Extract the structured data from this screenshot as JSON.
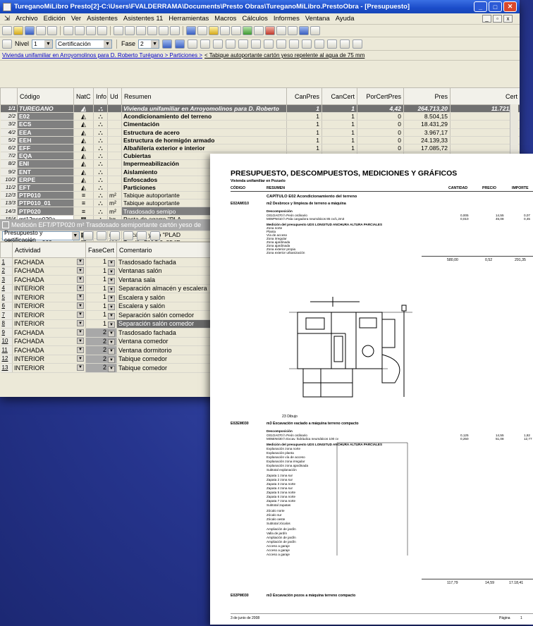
{
  "window": {
    "title": "TureganoMiLibro Presto[2]-C:\\Users\\FVALDERRAMA\\Documents\\Presto Obras\\TureganoMiLibro.PrestoObra - [Presupuesto]"
  },
  "menu": [
    "Archivo",
    "Edición",
    "Ver",
    "Asistentes",
    "Asistentes 11",
    "Herramientas",
    "Macros",
    "Cálculos",
    "Informes",
    "Ventana",
    "Ayuda"
  ],
  "filter": {
    "nivel_label": "Nivel",
    "nivel_value": "1",
    "certificacion_value": "Certificación",
    "fase_label": "Fase",
    "fase_value": "2"
  },
  "breadcrumb": {
    "path": "Vivienda unifamiliar en Arroyomolinos para D. Roberto Turégano > Particiones >",
    "current": "< Tabique autoportante cartón yeso repelente al agua de 75 mm"
  },
  "budget_grid": {
    "columns": [
      "Código",
      "NatC",
      "Info",
      "Ud",
      "Resumen",
      "CanPres",
      "CanCert",
      "PorCertPres",
      "Pres",
      "Cert"
    ],
    "rows": [
      {
        "n": "1/1",
        "code": "TUREGANO",
        "ud": "",
        "res": "Vivienda unifamiliar en Arroyomolinos para D. Roberto",
        "cp": "1",
        "cc": "1",
        "pcp": "4,42",
        "pres": "264.713,20",
        "cert": "11.721,68",
        "kind": "top"
      },
      {
        "n": "2/2",
        "code": "E02",
        "ud": "",
        "res": "Acondicionamiento del terreno",
        "cp": "1",
        "cc": "1",
        "pcp": "0",
        "pres": "8.504,15",
        "cert": "",
        "kind": "bold"
      },
      {
        "n": "3/2",
        "code": "ECS",
        "ud": "",
        "res": "Cimentación",
        "cp": "1",
        "cc": "1",
        "pcp": "0",
        "pres": "18.431,29",
        "cert": "",
        "kind": "bold"
      },
      {
        "n": "4/2",
        "code": "EEA",
        "ud": "",
        "res": "Estructura de acero",
        "cp": "1",
        "cc": "1",
        "pcp": "0",
        "pres": "3.967,17",
        "cert": "",
        "kind": "bold"
      },
      {
        "n": "5/2",
        "code": "EEH",
        "ud": "",
        "res": "Estructura de hormigón armado",
        "cp": "1",
        "cc": "1",
        "pcp": "0",
        "pres": "24.139,33",
        "cert": "",
        "kind": "bold"
      },
      {
        "n": "6/2",
        "code": "EFF",
        "ud": "",
        "res": "Albañilería exterior e interior",
        "cp": "1",
        "cc": "1",
        "pcp": "0",
        "pres": "17.085,72",
        "cert": "",
        "kind": "bold"
      },
      {
        "n": "7/2",
        "code": "EQA",
        "ud": "",
        "res": "Cubiertas",
        "cp": "1",
        "cc": "1",
        "pcp": "0",
        "pres": "5.861,87",
        "cert": "",
        "kind": "bold"
      },
      {
        "n": "8/2",
        "code": "ENI",
        "ud": "",
        "res": "Impermeabilización",
        "cp": "1",
        "cc": "1",
        "pcp": "0",
        "pres": "8.483,53",
        "cert": "",
        "kind": "bold"
      },
      {
        "n": "9/2",
        "code": "ENT",
        "ud": "",
        "res": "Aislamiento",
        "cp": "1",
        "cc": "1",
        "pcp": "0",
        "pres": "4.577,57",
        "cert": "",
        "kind": "bold"
      },
      {
        "n": "10/2",
        "code": "ERPE",
        "ud": "",
        "res": "Enfoscados",
        "cp": "",
        "cc": "",
        "pcp": "",
        "pres": "",
        "cert": "",
        "kind": "bold"
      },
      {
        "n": "11/2",
        "code": "EFT",
        "ud": "",
        "res": "Particiones",
        "cp": "",
        "cc": "",
        "pcp": "",
        "pres": "",
        "cert": "",
        "kind": "bold"
      },
      {
        "n": "12/3",
        "code": "PTP010",
        "ud": "m²",
        "res": "Tabique autoportante",
        "cp": "",
        "cc": "",
        "pcp": "",
        "pres": "",
        "cert": "",
        "kind": "plain"
      },
      {
        "n": "13/3",
        "code": "PTP010_01",
        "ud": "m²",
        "res": "Tabique autoportante",
        "cp": "",
        "cc": "",
        "pcp": "",
        "pres": "",
        "cert": "",
        "kind": "plain"
      },
      {
        "n": "14/3",
        "code": "PTP020",
        "ud": "m²",
        "res": "Trasdosado semipo",
        "cp": "",
        "cc": "",
        "pcp": "",
        "pres": "",
        "cert": "",
        "kind": "sel"
      },
      {
        "n": "15/4",
        "code": "mt12psp020a",
        "ud": "kg",
        "res": "Pasta de agarre \"PLA",
        "cp": "",
        "cc": "",
        "pcp": "",
        "pres": "",
        "cert": "",
        "kind": "leaf"
      },
      {
        "n": "16/4",
        "code": "mt12psp041a",
        "ud": "m",
        "res": "Maestra de chapa de",
        "cp": "",
        "cc": "",
        "pcp": "",
        "pres": "",
        "cert": "",
        "kind": "leaf"
      },
      {
        "n": "17/4",
        "code": "mt12psp010ab",
        "ud": "m²",
        "res": "Placa de yeso \"PLAD",
        "cp": "",
        "cc": "",
        "pcp": "",
        "pres": "",
        "cert": "",
        "kind": "leaf"
      },
      {
        "n": "18/4",
        "code": "mt12psp060ae",
        "ud": "Ud",
        "res": "Tornillo PM 3,9x25 \"P",
        "cp": "",
        "cc": "",
        "pcp": "",
        "pres": "",
        "cert": "",
        "kind": "leaf"
      }
    ]
  },
  "measure_panel": {
    "title": "Medición EFT/PTP020 m² Trasdosado semiportante cartón yeso de",
    "mode": "Presupuesto y certificación",
    "columns": [
      "Actividad",
      "FaseCert",
      "Comentario"
    ],
    "rows": [
      {
        "n": "1",
        "act": "FACHADA",
        "fase": "1",
        "com": "Trasdosado fachada"
      },
      {
        "n": "2",
        "act": "FACHADA",
        "fase": "1",
        "com": "Ventanas salón"
      },
      {
        "n": "3",
        "act": "FACHADA",
        "fase": "1",
        "com": "Ventana sala"
      },
      {
        "n": "4",
        "act": "INTERIOR",
        "fase": "1",
        "com": "Separación almacén y escalera"
      },
      {
        "n": "5",
        "act": "INTERIOR",
        "fase": "1",
        "com": "Escalera y salón"
      },
      {
        "n": "6",
        "act": "INTERIOR",
        "fase": "1",
        "com": "Escalera y salón"
      },
      {
        "n": "7",
        "act": "INTERIOR",
        "fase": "1",
        "com": "Separación salón comedor"
      },
      {
        "n": "8",
        "act": "INTERIOR",
        "fase": "1",
        "com": "Separación salón comedor"
      },
      {
        "n": "9",
        "act": "FACHADA",
        "fase": "2",
        "com": "Trasdosado fachada"
      },
      {
        "n": "10",
        "act": "FACHADA",
        "fase": "2",
        "com": "Ventana comedor"
      },
      {
        "n": "11",
        "act": "FACHADA",
        "fase": "2",
        "com": "Ventana dormitorio"
      },
      {
        "n": "12",
        "act": "INTERIOR",
        "fase": "2",
        "com": "Tabique comedor"
      },
      {
        "n": "13",
        "act": "INTERIOR",
        "fase": "2",
        "com": "Tabique comedor"
      }
    ]
  },
  "report": {
    "title": "PRESUPUESTO, DESCOMPUESTOS, MEDICIONES Y GRÁFICOS",
    "subtitle": "Vivienda unifamiliar en Pozuelo",
    "headers": [
      "CÓDIGO",
      "RESUMEN",
      "CANTIDAD",
      "PRECIO",
      "IMPORTE"
    ],
    "chapter": "CAPÍTULO E02 Acondicionamiento del terreno",
    "item1_code": "E02AM010",
    "item1_desc": "m2  Desbroce y limpieza de terreno a máquina",
    "item2_code": "E02EM030",
    "item2_desc": "m3  Excavación vaciado a máquina terreno compacto",
    "item3_code": "E02PM030",
    "item3_desc": "m3  Excavación pozos a máquina terreno compacto",
    "drawing_label": "23 Dibujo",
    "date": "3 de junio de 2008",
    "page_label": "Página",
    "page_num": "1",
    "total1": "580,00",
    "price1": "0,52",
    "amount1": "291,35",
    "total2": "117,79",
    "price2": "14,59",
    "amount2": "17.18,41"
  }
}
